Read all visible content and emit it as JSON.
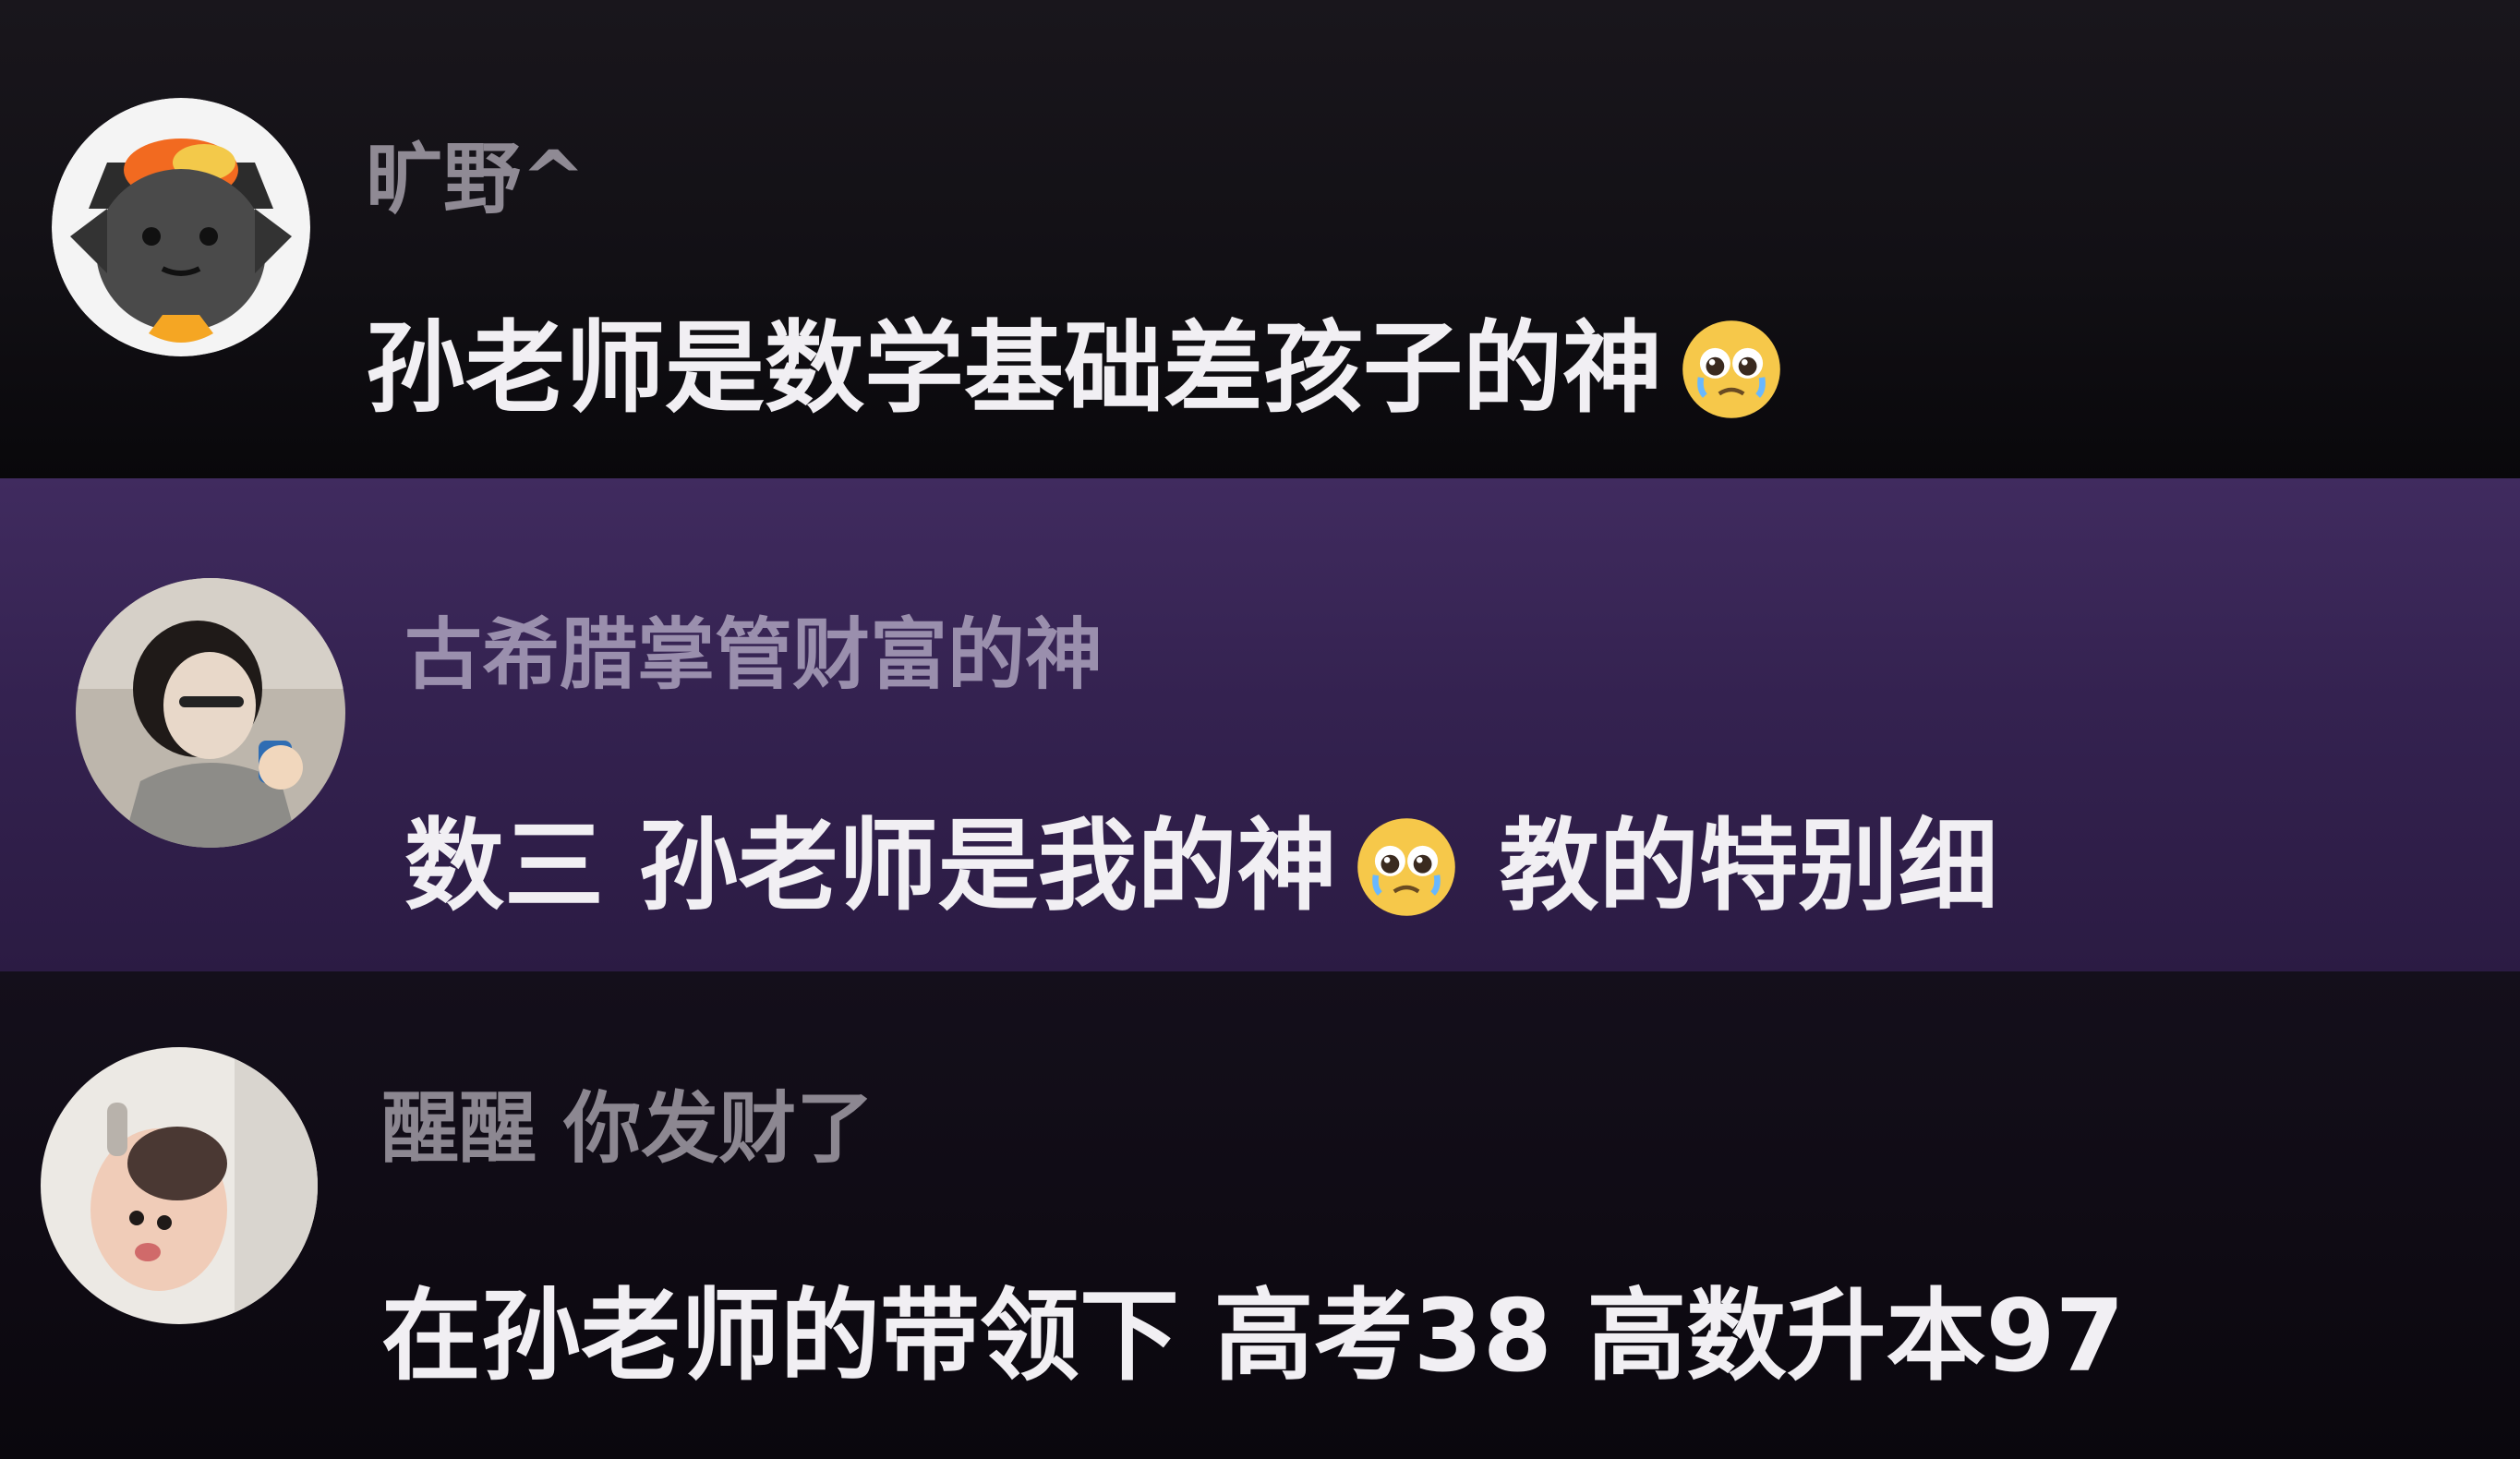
{
  "comments": [
    {
      "username": "旷野^",
      "text": "孙老师是数学基础差孩子的神",
      "emoji": "pleading-face-icon"
    },
    {
      "username": "古希腊掌管财富的神",
      "text_before": "数三 孙老师是我的神",
      "text_after": "教的特别细",
      "emoji": "pleading-face-icon"
    },
    {
      "username": "醒醒 你发财了",
      "text": "在孙老师的带领下 高考38 高数升本97"
    }
  ]
}
